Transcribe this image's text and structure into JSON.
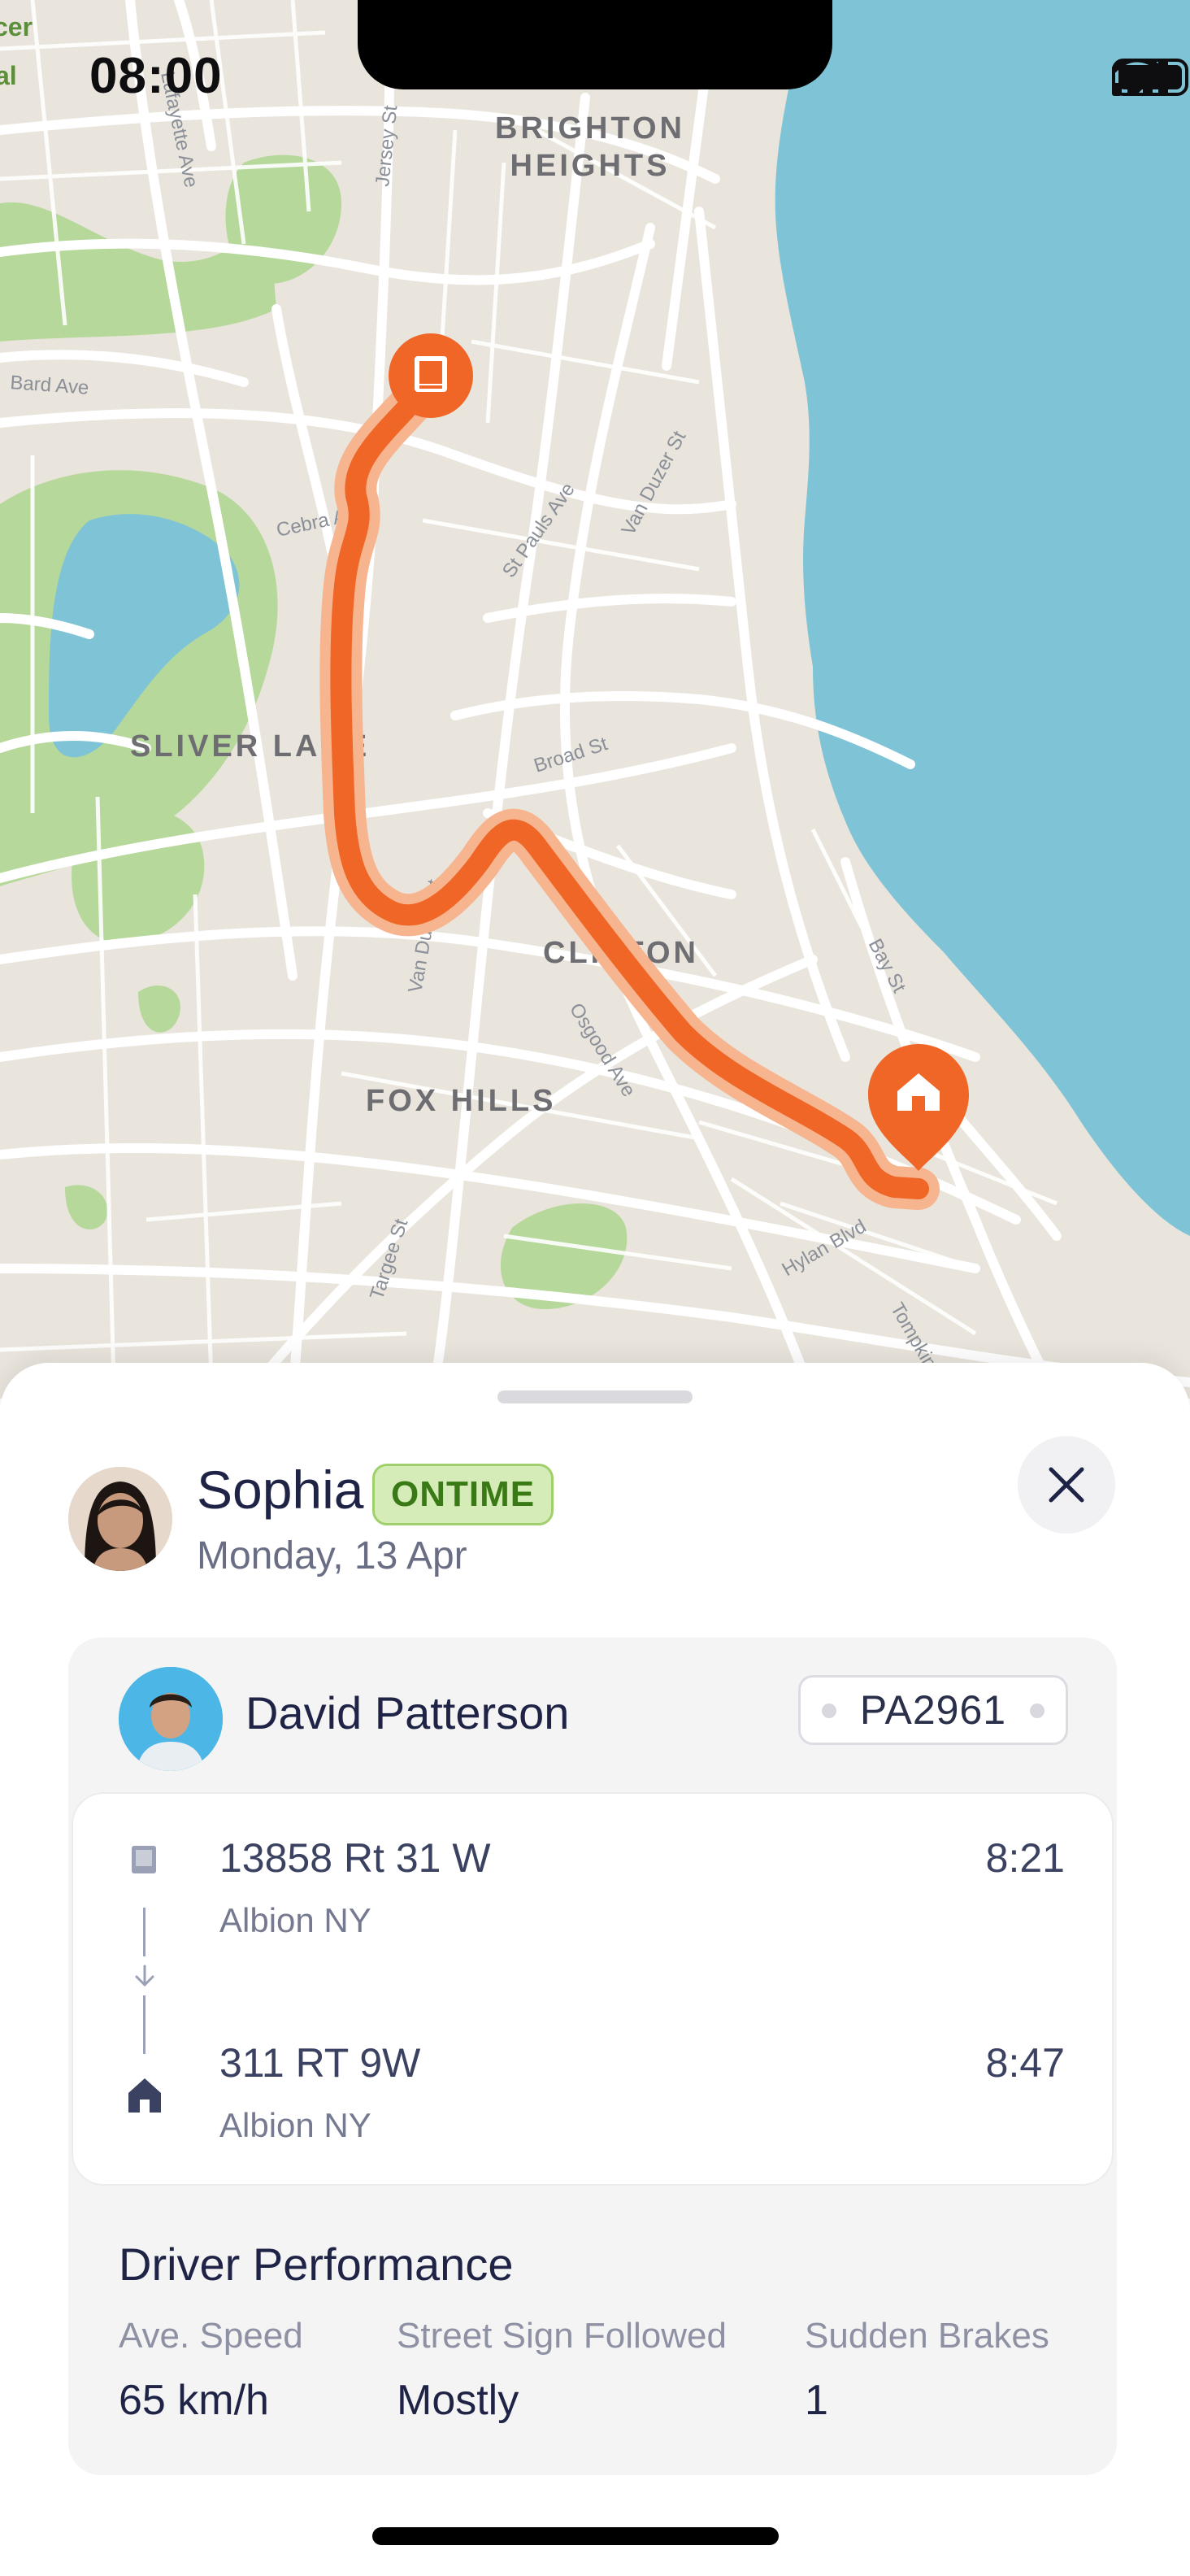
{
  "status_bar": {
    "time": "08:00"
  },
  "map": {
    "area_labels": [
      "BRIGHTON",
      "HEIGHTS",
      "SLIVER LAKE",
      "CLIFTON",
      "FOX HILLS"
    ],
    "street_labels": [
      "Lafayette Ave",
      "Jersey St",
      "Bard Ave",
      "Cebra Ave",
      "St Pauls Ave",
      "Van Duzer St",
      "Broad St",
      "Van Duzer St",
      "Osgood Ave",
      "Bay St",
      "Targee St",
      "Hylan Blvd",
      "Tompkins Ave"
    ],
    "edge_labels": [
      "cer",
      "al"
    ],
    "route_color": "#ef6626",
    "water_color": "#7fc4d6",
    "park_color": "#b7d89b"
  },
  "rider": {
    "name": "Sophia",
    "status": "ONTIME",
    "date": "Monday, 13 Apr"
  },
  "driver": {
    "name": "David Patterson",
    "plate": "PA2961"
  },
  "route": {
    "pickup": {
      "address": "13858 Rt 31 W",
      "city": "Albion NY",
      "time": "8:21",
      "icon": "book-icon"
    },
    "dropoff": {
      "address": "311 RT 9W",
      "city": "Albion NY",
      "time": "8:47",
      "icon": "home-icon"
    }
  },
  "performance": {
    "title": "Driver Performance",
    "metrics": [
      {
        "label": "Ave. Speed",
        "value": "65 km/h"
      },
      {
        "label": "Street Sign Followed",
        "value": "Mostly"
      },
      {
        "label": "Sudden Brakes",
        "value": "1"
      }
    ]
  }
}
